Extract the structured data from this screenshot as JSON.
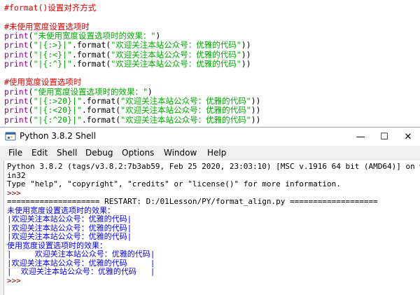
{
  "editor": {
    "lines": [
      [
        {
          "t": "#format()设置对齐方式",
          "c": "tk-c"
        }
      ],
      [],
      [
        {
          "t": "#未使用宽度设置选项时",
          "c": "tk-c"
        }
      ],
      [
        {
          "t": "print",
          "c": "tk-k"
        },
        {
          "t": "(",
          "c": "tk-d"
        },
        {
          "t": "\"未使用宽度设置选项时的效果：\"",
          "c": "tk-s"
        },
        {
          "t": ")",
          "c": "tk-d"
        }
      ],
      [
        {
          "t": "print",
          "c": "tk-k"
        },
        {
          "t": "(",
          "c": "tk-d"
        },
        {
          "t": "\"|{:>}|\"",
          "c": "tk-s"
        },
        {
          "t": ".format(",
          "c": "tk-d"
        },
        {
          "t": "\"欢迎关注本站公众号：优雅的代码\"",
          "c": "tk-s"
        },
        {
          "t": "))",
          "c": "tk-d"
        }
      ],
      [
        {
          "t": "print",
          "c": "tk-k"
        },
        {
          "t": "(",
          "c": "tk-d"
        },
        {
          "t": "\"|{:<}|\"",
          "c": "tk-s"
        },
        {
          "t": ".format(",
          "c": "tk-d"
        },
        {
          "t": "\"欢迎关注本站公众号：优雅的代码\"",
          "c": "tk-s"
        },
        {
          "t": "))",
          "c": "tk-d"
        }
      ],
      [
        {
          "t": "print",
          "c": "tk-k"
        },
        {
          "t": "(",
          "c": "tk-d"
        },
        {
          "t": "\"|{:^}|\"",
          "c": "tk-s"
        },
        {
          "t": ".format(",
          "c": "tk-d"
        },
        {
          "t": "\"欢迎关注本站公众号：优雅的代码\"",
          "c": "tk-s"
        },
        {
          "t": "))",
          "c": "tk-d"
        }
      ],
      [],
      [
        {
          "t": "#使用宽度设置选项时",
          "c": "tk-c"
        }
      ],
      [
        {
          "t": "print",
          "c": "tk-k"
        },
        {
          "t": "(",
          "c": "tk-d"
        },
        {
          "t": "\"使用宽度设置选项时的效果：\"",
          "c": "tk-s"
        },
        {
          "t": ")",
          "c": "tk-d"
        }
      ],
      [
        {
          "t": "print",
          "c": "tk-k"
        },
        {
          "t": "(",
          "c": "tk-d"
        },
        {
          "t": "\"|{:>20}|\"",
          "c": "tk-s"
        },
        {
          "t": ".format(",
          "c": "tk-d"
        },
        {
          "t": "\"欢迎关注本站公众号：优雅的代码\"",
          "c": "tk-s"
        },
        {
          "t": "))",
          "c": "tk-d"
        }
      ],
      [
        {
          "t": "print",
          "c": "tk-k"
        },
        {
          "t": "(",
          "c": "tk-d"
        },
        {
          "t": "\"|{:<20}|\"",
          "c": "tk-s"
        },
        {
          "t": ".format(",
          "c": "tk-d"
        },
        {
          "t": "\"欢迎关注本站公众号：优雅的代码\"",
          "c": "tk-s"
        },
        {
          "t": "))",
          "c": "tk-d"
        }
      ],
      [
        {
          "t": "print",
          "c": "tk-k"
        },
        {
          "t": "(",
          "c": "tk-d"
        },
        {
          "t": "\"|{:^20}|\"",
          "c": "tk-s"
        },
        {
          "t": ".format(",
          "c": "tk-d"
        },
        {
          "t": "\"欢迎关注本站公众号：优雅的代码\"",
          "c": "tk-s"
        },
        {
          "t": "))",
          "c": "tk-d"
        }
      ]
    ]
  },
  "window": {
    "title": "Python 3.8.2 Shell",
    "minimize_label": "—",
    "maximize_label": "☐",
    "close_label": "✕"
  },
  "menu": {
    "items": [
      "File",
      "Edit",
      "Shell",
      "Debug",
      "Options",
      "Window",
      "Help"
    ]
  },
  "shell": {
    "lines": [
      {
        "t": "Python 3.8.2 (tags/v3.8.2:7b3ab59, Feb 25 2020, 23:03:10) [MSC v.1916 64 bit (AMD64)] on w",
        "c": "black"
      },
      {
        "t": "in32",
        "c": "black"
      },
      {
        "t": "Type \"help\", \"copyright\", \"credits\" or \"license()\" for more information.",
        "c": "black"
      },
      {
        "t": ">>> ",
        "c": "prompt"
      },
      {
        "t": "==================== RESTART: D:/01Lesson/PY/format_align.py ===================",
        "c": "restart"
      },
      {
        "t": "未使用宽度设置选项时的效果：",
        "c": "blue"
      },
      {
        "t": "|欢迎关注本站公众号：优雅的代码|",
        "c": "blue"
      },
      {
        "t": "|欢迎关注本站公众号：优雅的代码|",
        "c": "blue"
      },
      {
        "t": "|欢迎关注本站公众号：优雅的代码|",
        "c": "blue"
      },
      {
        "t": "使用宽度设置选项时的效果：",
        "c": "blue"
      },
      {
        "t": "|     欢迎关注本站公众号：优雅的代码|",
        "c": "blue"
      },
      {
        "t": "|欢迎关注本站公众号：优雅的代码     |",
        "c": "blue"
      },
      {
        "t": "|  欢迎关注本站公众号：优雅的代码   |",
        "c": "blue"
      },
      {
        "t": ">>> ",
        "c": "prompt"
      }
    ]
  },
  "colors": {
    "comment": "#dd0000",
    "keyword": "#900090",
    "string": "#00aa00",
    "output": "#0000ff",
    "prompt": "#8b0000"
  },
  "icons": {
    "app": "python-idle-icon"
  }
}
